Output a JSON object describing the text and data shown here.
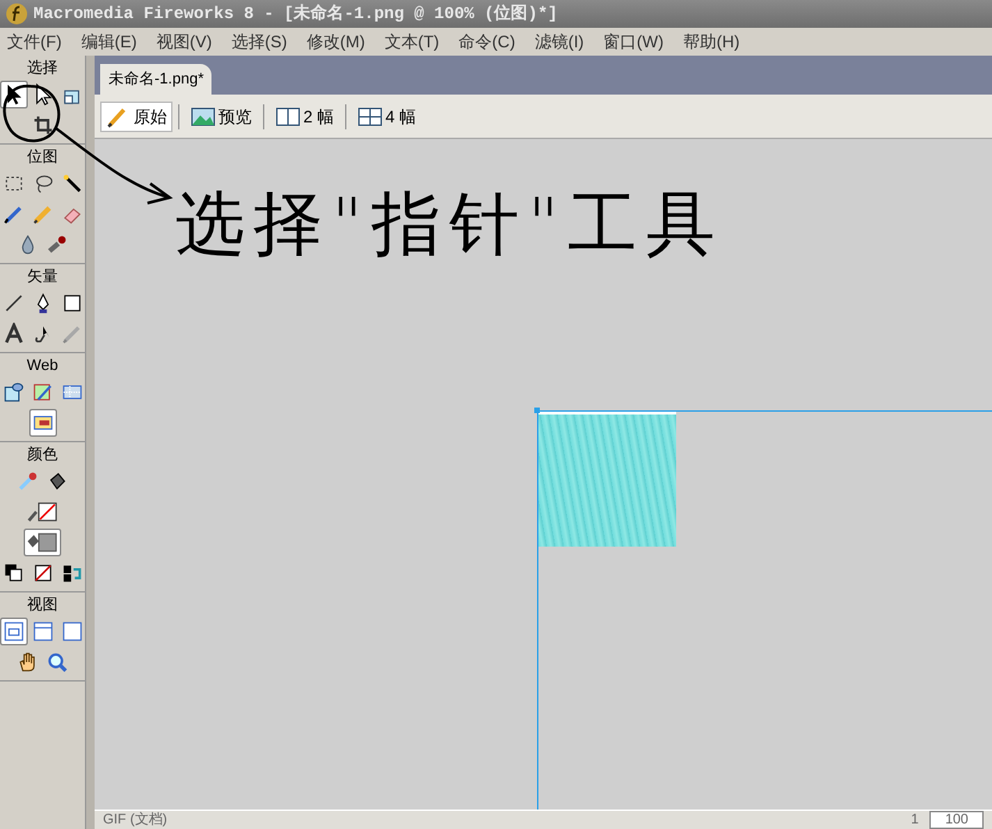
{
  "window": {
    "title": "Macromedia Fireworks 8 - [未命名-1.png @ 100% (位图)*]"
  },
  "menu": [
    "文件(F)",
    "编辑(E)",
    "视图(V)",
    "选择(S)",
    "修改(M)",
    "文本(T)",
    "命令(C)",
    "滤镜(I)",
    "窗口(W)",
    "帮助(H)"
  ],
  "toolbox": [
    {
      "label": "选择",
      "tools": [
        {
          "kind": "pointer",
          "selected": true
        },
        {
          "kind": "subselect",
          "selected": false
        },
        {
          "kind": "scale",
          "selected": false
        },
        {
          "kind": "crop",
          "selected": false
        }
      ]
    },
    {
      "label": "位图",
      "tools": [
        {
          "kind": "marquee",
          "selected": false
        },
        {
          "kind": "lasso",
          "selected": false
        },
        {
          "kind": "wand",
          "selected": false
        },
        {
          "kind": "brush",
          "selected": false
        },
        {
          "kind": "pencil",
          "selected": false
        },
        {
          "kind": "eraser",
          "selected": false
        },
        {
          "kind": "blur",
          "selected": false
        },
        {
          "kind": "stamp",
          "selected": false
        }
      ]
    },
    {
      "label": "矢量",
      "tools": [
        {
          "kind": "line",
          "selected": false
        },
        {
          "kind": "pen",
          "selected": false
        },
        {
          "kind": "rect",
          "selected": false
        },
        {
          "kind": "text",
          "selected": false
        },
        {
          "kind": "knife",
          "selected": false
        },
        {
          "kind": "freeform",
          "selected": false
        }
      ]
    },
    {
      "label": "Web",
      "tools": [
        {
          "kind": "hotspot",
          "selected": false
        },
        {
          "kind": "slice",
          "selected": false
        },
        {
          "kind": "hideslices",
          "selected": false
        },
        {
          "kind": "showslices",
          "selected": true
        }
      ]
    },
    {
      "label": "颜色",
      "tools": [
        {
          "kind": "eyedropper",
          "selected": false
        },
        {
          "kind": "bucket",
          "selected": false
        },
        {
          "kind": "strokecolor",
          "selected": false
        },
        {
          "kind": "fillcolor",
          "selected": true
        },
        {
          "kind": "defaults",
          "selected": false
        },
        {
          "kind": "nocolor",
          "selected": false
        },
        {
          "kind": "swap",
          "selected": false
        }
      ]
    },
    {
      "label": "视图",
      "tools": [
        {
          "kind": "standard",
          "selected": true
        },
        {
          "kind": "fullmenu",
          "selected": false
        },
        {
          "kind": "full",
          "selected": false
        },
        {
          "kind": "hand",
          "selected": false
        },
        {
          "kind": "zoom",
          "selected": false
        }
      ]
    }
  ],
  "document": {
    "tab": "未命名-1.png*",
    "views": [
      {
        "kind": "original",
        "label": "原始",
        "selected": true
      },
      {
        "kind": "preview",
        "label": "预览",
        "selected": false
      },
      {
        "kind": "two",
        "label": "2 幅",
        "selected": false
      },
      {
        "kind": "four",
        "label": "4 幅",
        "selected": false
      }
    ],
    "annotation": "选择\"指针\"工具",
    "status": {
      "format": "GIF (文档)",
      "frame": "1",
      "zoom": "100"
    }
  }
}
